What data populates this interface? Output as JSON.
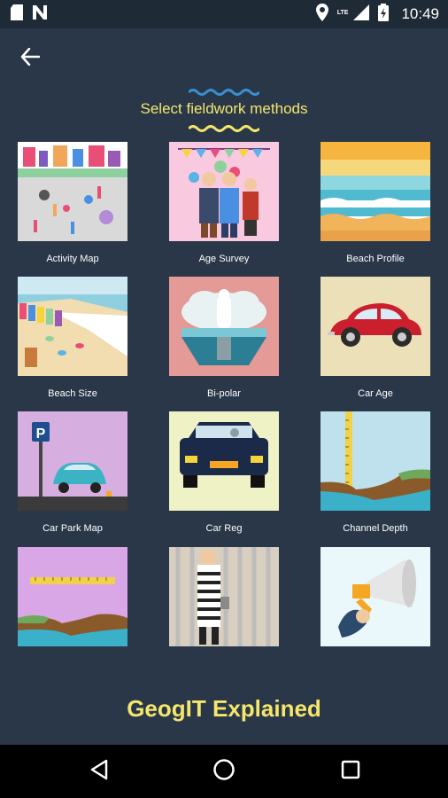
{
  "status_bar": {
    "time": "10:49",
    "network": "LTE",
    "icons": [
      "sd-card-icon",
      "notification-n-icon",
      "location-icon",
      "signal-icon",
      "battery-charging-icon"
    ]
  },
  "header": {
    "back_icon": "arrow-left-icon",
    "title": "Select fieldwork methods"
  },
  "methods": [
    {
      "label": "Activity Map"
    },
    {
      "label": "Age Survey"
    },
    {
      "label": "Beach Profile"
    },
    {
      "label": "Beach Size"
    },
    {
      "label": "Bi-polar"
    },
    {
      "label": "Car Age"
    },
    {
      "label": "Car Park Map"
    },
    {
      "label": "Car Reg"
    },
    {
      "label": "Channel Depth"
    },
    {
      "label": ""
    },
    {
      "label": ""
    },
    {
      "label": ""
    }
  ],
  "footer": {
    "title": "GeogIT Explained"
  },
  "nav_bar": {
    "icons": [
      "back-triangle-icon",
      "home-circle-icon",
      "recents-square-icon"
    ]
  },
  "colors": {
    "background": "#293749",
    "accent_yellow": "#f5e66c",
    "wave_blue": "#3a8fd0"
  }
}
